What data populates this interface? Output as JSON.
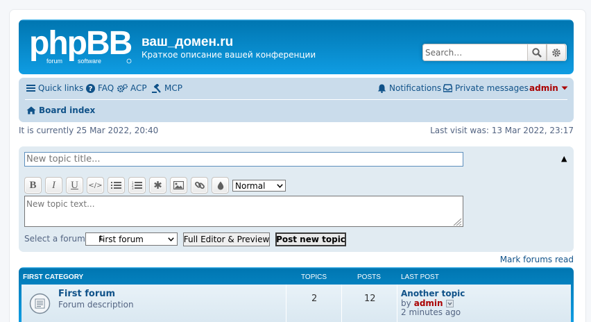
{
  "header": {
    "site_name": "ваш_домен.ru",
    "site_description": "Краткое описание вашей конференции",
    "logo_text": "phpBB",
    "logo_sub": "forum software",
    "search_placeholder": "Search…"
  },
  "navbar": {
    "quick_links": "Quick links",
    "faq": "FAQ",
    "acp": "ACP",
    "mcp": "MCP",
    "notifications": "Notifications",
    "private_messages": "Private messages",
    "username": "admin",
    "board_index": "Board index"
  },
  "times": {
    "current": "It is currently 25 Mar 2022, 20:40",
    "last_visit": "Last visit was: 13 Mar 2022, 23:17"
  },
  "posting": {
    "title_placeholder": "New topic title...",
    "text_placeholder": "New topic text...",
    "font_size_value": "Normal",
    "select_forum_label": "Select a forum",
    "forum_selected": "First forum",
    "full_editor_button": "Full Editor & Preview",
    "post_button": "Post new topic",
    "toolbar": [
      {
        "icon": "bold-icon",
        "glyph": "B"
      },
      {
        "icon": "italic-icon",
        "glyph": "I"
      },
      {
        "icon": "underline-icon",
        "glyph": "U"
      },
      {
        "icon": "code-icon",
        "glyph": "</>"
      },
      {
        "icon": "list-icon",
        "glyph": "≡"
      },
      {
        "icon": "ordered-list-icon",
        "glyph": "≡"
      },
      {
        "icon": "asterisk-icon",
        "glyph": "✱"
      },
      {
        "icon": "image-icon",
        "glyph": "▣"
      },
      {
        "icon": "link-icon",
        "glyph": "⚭"
      },
      {
        "icon": "color-icon",
        "glyph": "●"
      }
    ]
  },
  "mark_forums_read": "Mark forums read",
  "forum_list": {
    "headers": {
      "category": "FIRST CATEGORY",
      "topics": "TOPICS",
      "posts": "POSTS",
      "last_post": "LAST POST"
    },
    "rows": [
      {
        "title": "First forum",
        "description": "Forum description",
        "topics": "2",
        "posts": "12",
        "last_post_title": "Another topic",
        "last_post_by": "by",
        "last_post_author": "admin",
        "last_post_time": "2 minutes ago"
      }
    ]
  },
  "colors": {
    "header_blue": "#12A3EB",
    "nav_bg": "#CADCEB",
    "link": "#105289",
    "admin_red": "#AA0000"
  }
}
